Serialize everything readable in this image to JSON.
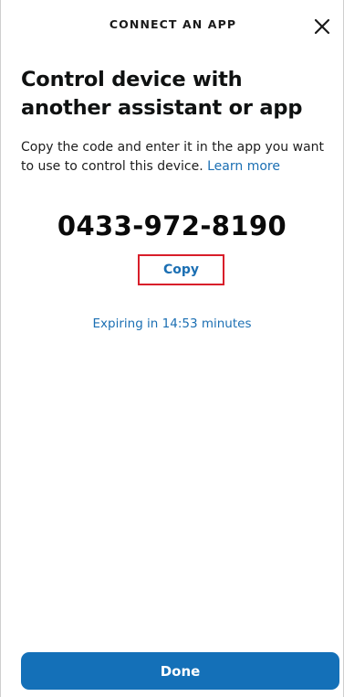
{
  "header": {
    "title": "CONNECT AN APP",
    "close_icon": "close-icon"
  },
  "main": {
    "heading": "Control device with another assistant or app",
    "description": "Copy the code and enter it in the app you want to use to control this device.",
    "learn_more_link": "Learn more",
    "code": "0433-972-8190",
    "copy_label": "Copy",
    "expiry_text": "Expiring in 14:53 minutes"
  },
  "footer": {
    "done_label": "Done"
  },
  "colors": {
    "accent": "#1470b8",
    "link": "#1b6fb3",
    "highlight_border": "#d81e2a"
  }
}
